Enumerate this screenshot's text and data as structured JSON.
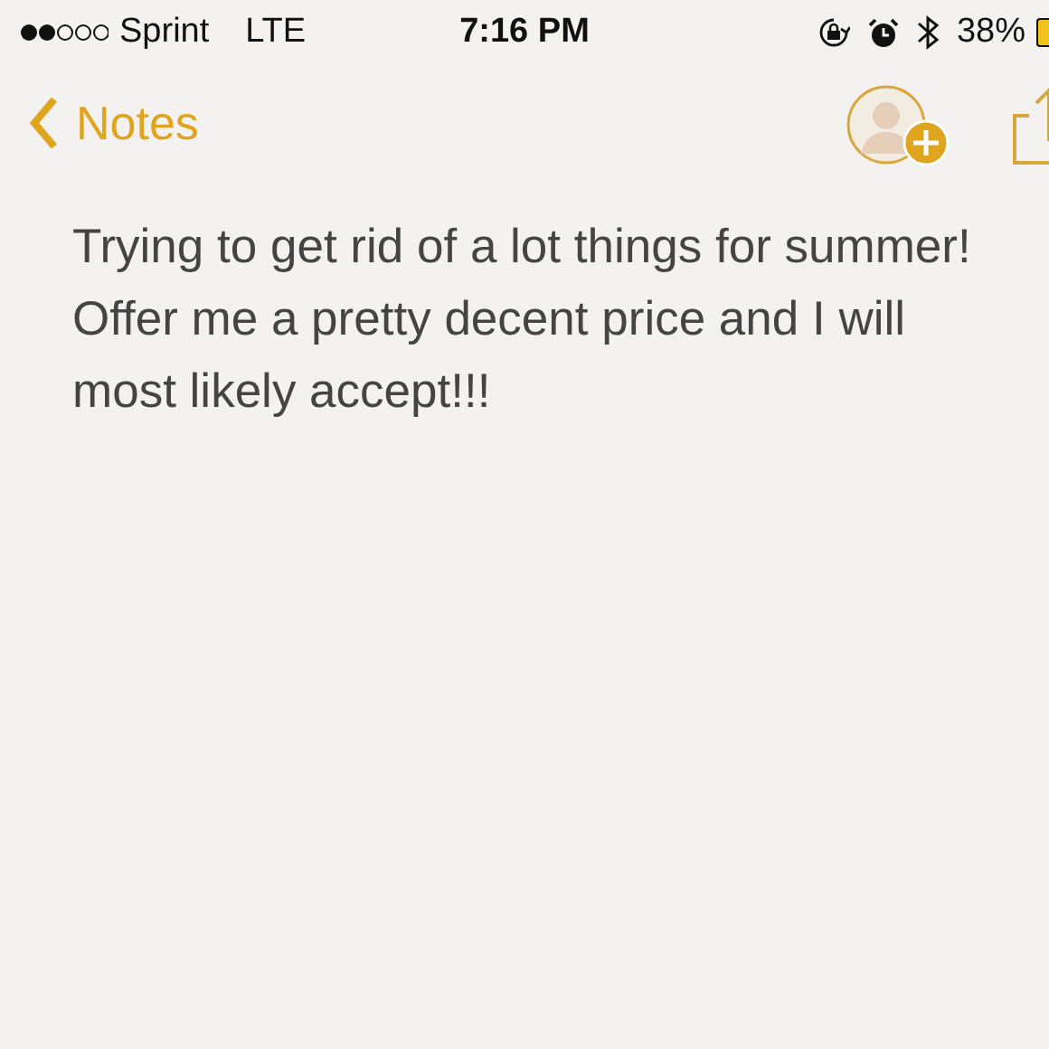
{
  "status_bar": {
    "carrier": "Sprint",
    "network": "LTE",
    "time": "7:16 PM",
    "battery": "38%"
  },
  "nav_bar": {
    "back": "Notes"
  },
  "note": {
    "text": "Trying to get rid of a lot things for summer! Offer me a pretty decent price and I will most likely accept!!!"
  }
}
